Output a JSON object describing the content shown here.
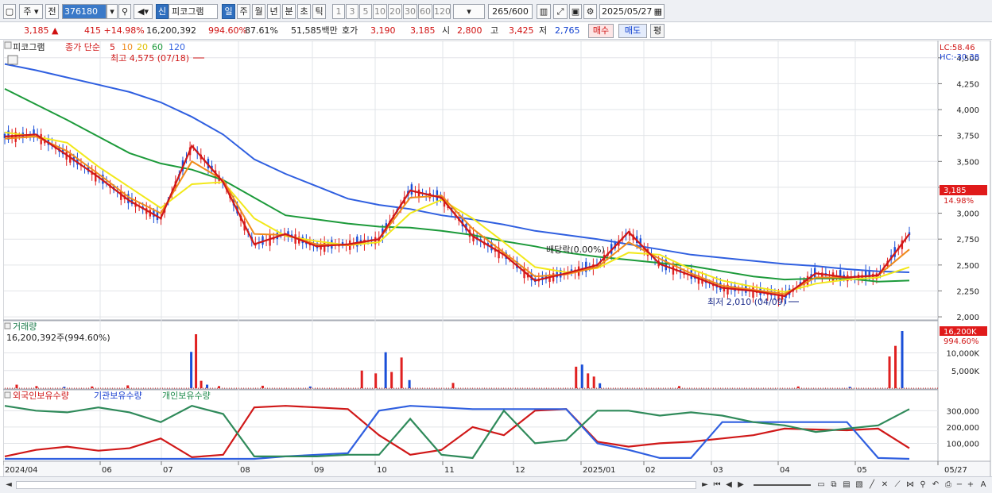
{
  "toolbar": {
    "market": "주",
    "prev": "전",
    "code": "376180",
    "shin": "신",
    "name": "피코그램",
    "periods": [
      "일",
      "주",
      "월",
      "년",
      "분",
      "초",
      "틱"
    ],
    "active_period": "일",
    "intervals": [
      "1",
      "3",
      "5",
      "10",
      "20",
      "30",
      "60",
      "120"
    ],
    "count": "265",
    "count_total": "/600",
    "date": "2025/05/27"
  },
  "quote": {
    "price": "3,185",
    "change_arrow": "▲",
    "change": "415",
    "change_pct": "+14.98%",
    "volume": "16,200,392",
    "volume_ratio": "994.60%",
    "turnover": "87.61%",
    "amount": "51,585백만",
    "hoga_label": "호가",
    "ask": "3,190",
    "bid": "3,185",
    "open_label": "시",
    "open": "2,800",
    "high_label": "고",
    "high": "3,425",
    "low_label": "저",
    "low": "2,765",
    "buy": "매수",
    "sell": "매도",
    "extra": "평"
  },
  "main_panel": {
    "title": "피코그램",
    "ma_label": "종가 단순",
    "ma_periods": [
      "5",
      "10",
      "20",
      "60",
      "120"
    ],
    "high_note": "최고 4,575 (07/18)",
    "low_note": "최저 2,010 (04/09)",
    "ex_div": "배당락(0.00%)",
    "lc": "LC:58.46",
    "hc": "HC:-30.38",
    "price_tag": "3,185",
    "pct_tag": "14.98%"
  },
  "volume_panel": {
    "title": "거래량",
    "value": "16,200,392주(994.60%)",
    "tag": "16,200K",
    "tag_pct": "994.60%"
  },
  "holding_panel": {
    "foreign": "외국인보유수량",
    "institution": "기관보유수량",
    "individual": "개인보유수량"
  },
  "colors": {
    "ma5": "#d01818",
    "ma10": "#f08a1a",
    "ma20": "#f2e81a",
    "ma60": "#1c9a3a",
    "ma120": "#2f5fe0",
    "up": "#e02020",
    "down": "#1a4fd8"
  },
  "chart_data": [
    {
      "type": "line",
      "title": "",
      "x_ticks": [
        "2024/04",
        "06",
        "07",
        "08",
        "09",
        "10",
        "11",
        "12",
        "2025/01",
        "02",
        "03",
        "04",
        "05",
        "05/27"
      ],
      "y_ticks": [
        2000,
        2250,
        2500,
        2750,
        3000,
        3250,
        3500,
        3750,
        4000,
        4250,
        4500
      ],
      "ylim": [
        1970,
        4575
      ],
      "series": [
        {
          "name": "5",
          "values": [
            3740,
            3760,
            3560,
            3350,
            3120,
            2950,
            3650,
            3300,
            2700,
            2800,
            2680,
            2700,
            2750,
            3220,
            3150,
            2780,
            2600,
            2350,
            2420,
            2500,
            2820,
            2510,
            2400,
            2280,
            2250,
            2200,
            2420,
            2380,
            2400,
            2800
          ]
        },
        {
          "name": "10",
          "values": [
            3720,
            3740,
            3600,
            3380,
            3150,
            3000,
            3500,
            3320,
            2800,
            2790,
            2700,
            2690,
            2750,
            3150,
            3170,
            2850,
            2620,
            2390,
            2410,
            2480,
            2720,
            2560,
            2420,
            2300,
            2260,
            2220,
            2380,
            2380,
            2400,
            2650
          ]
        },
        {
          "name": "20",
          "values": [
            3780,
            3740,
            3680,
            3450,
            3250,
            3050,
            3280,
            3300,
            2950,
            2780,
            2730,
            2690,
            2720,
            3000,
            3130,
            2950,
            2720,
            2480,
            2430,
            2470,
            2620,
            2600,
            2460,
            2350,
            2290,
            2240,
            2320,
            2360,
            2380,
            2480
          ]
        },
        {
          "name": "60",
          "values": [
            4200,
            4050,
            3900,
            3740,
            3580,
            3480,
            3420,
            3320,
            3150,
            2980,
            2940,
            2900,
            2870,
            2860,
            2830,
            2790,
            2730,
            2680,
            2620,
            2580,
            2550,
            2520,
            2490,
            2440,
            2390,
            2360,
            2370,
            2370,
            2340,
            2350
          ]
        },
        {
          "name": "120",
          "values": [
            4440,
            4380,
            4310,
            4240,
            4170,
            4070,
            3930,
            3760,
            3520,
            3380,
            3260,
            3140,
            3080,
            3040,
            2980,
            2940,
            2890,
            2830,
            2790,
            2750,
            2700,
            2650,
            2600,
            2570,
            2540,
            2510,
            2490,
            2460,
            2440,
            2430
          ]
        }
      ]
    },
    {
      "type": "bar",
      "title": "",
      "y_ticks": [
        "5,000K",
        "10,000K"
      ],
      "categories_note": "daily volume (K shares)",
      "values": [
        {
          "x": 0.3,
          "v": 1000
        },
        {
          "x": 0.8,
          "v": 600
        },
        {
          "x": 1.5,
          "v": 400
        },
        {
          "x": 2.2,
          "v": 500
        },
        {
          "x": 3.1,
          "v": 800
        },
        {
          "x": 4.7,
          "v": 10300
        },
        {
          "x": 4.82,
          "v": 15300
        },
        {
          "x": 4.95,
          "v": 2100
        },
        {
          "x": 5.1,
          "v": 1000
        },
        {
          "x": 5.4,
          "v": 600
        },
        {
          "x": 6.5,
          "v": 700
        },
        {
          "x": 7.7,
          "v": 500
        },
        {
          "x": 9.0,
          "v": 5000
        },
        {
          "x": 9.35,
          "v": 4200
        },
        {
          "x": 9.6,
          "v": 10200
        },
        {
          "x": 9.75,
          "v": 4600
        },
        {
          "x": 10.0,
          "v": 8700
        },
        {
          "x": 10.2,
          "v": 2300
        },
        {
          "x": 11.3,
          "v": 1500
        },
        {
          "x": 14.4,
          "v": 6100
        },
        {
          "x": 14.55,
          "v": 6700
        },
        {
          "x": 14.7,
          "v": 4200
        },
        {
          "x": 14.85,
          "v": 3300
        },
        {
          "x": 15.0,
          "v": 1400
        },
        {
          "x": 17.0,
          "v": 600
        },
        {
          "x": 20.0,
          "v": 500
        },
        {
          "x": 21.3,
          "v": 400
        },
        {
          "x": 22.3,
          "v": 9000
        },
        {
          "x": 22.45,
          "v": 12000
        },
        {
          "x": 22.62,
          "v": 16200
        }
      ]
    },
    {
      "type": "line",
      "title": "",
      "y_ticks": [
        "100,000",
        "200,000",
        "300,000"
      ],
      "ylim": [
        0,
        360000
      ],
      "series": [
        {
          "name": "외국인보유수량",
          "values": [
            20000,
            60000,
            80000,
            55000,
            70000,
            130000,
            15000,
            30000,
            320000,
            330000,
            320000,
            310000,
            150000,
            30000,
            60000,
            200000,
            150000,
            300000,
            310000,
            110000,
            80000,
            100000,
            110000,
            130000,
            150000,
            190000,
            185000,
            180000,
            190000,
            70000
          ]
        },
        {
          "name": "기관보유수량",
          "values": [
            5000,
            5000,
            5000,
            5000,
            5000,
            5000,
            5000,
            5000,
            5000,
            20000,
            30000,
            40000,
            300000,
            330000,
            320000,
            310000,
            310000,
            310000,
            310000,
            100000,
            60000,
            10000,
            10000,
            230000,
            230000,
            230000,
            230000,
            230000,
            10000,
            5000
          ]
        },
        {
          "name": "개인보유수량",
          "values": [
            330000,
            300000,
            290000,
            320000,
            290000,
            230000,
            330000,
            280000,
            20000,
            20000,
            20000,
            30000,
            30000,
            250000,
            30000,
            10000,
            300000,
            100000,
            120000,
            300000,
            300000,
            270000,
            290000,
            270000,
            230000,
            210000,
            170000,
            190000,
            210000,
            310000
          ]
        }
      ]
    }
  ],
  "statusbar": {
    "scroll_left": "◄",
    "play": "►",
    "minus": "−",
    "plus": "+",
    "font": "A"
  }
}
